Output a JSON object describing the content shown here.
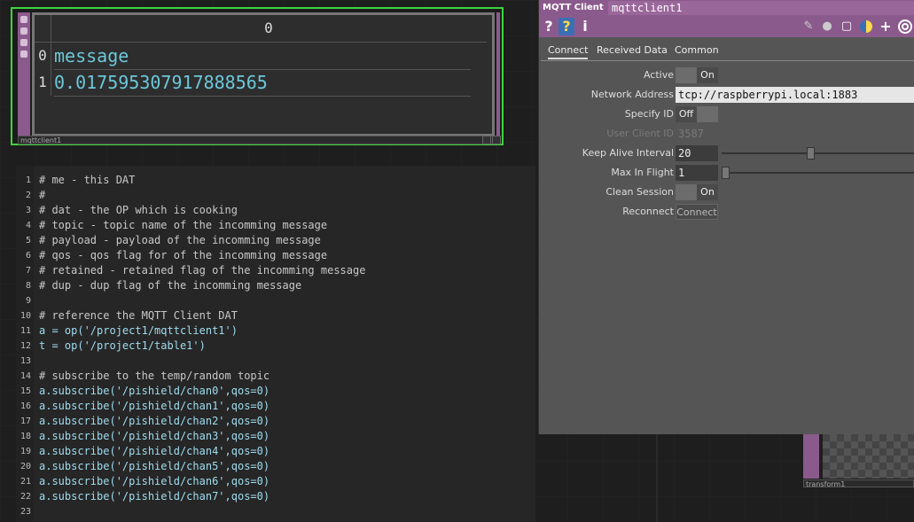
{
  "table_node": {
    "col_header": "0",
    "rows": [
      {
        "index": "0",
        "value": "message"
      },
      {
        "index": "1",
        "value": "0.017595307917888565"
      }
    ],
    "label": "mqttclient1"
  },
  "code": {
    "lines": [
      {
        "n": "1",
        "t": "# me - this DAT",
        "kind": "comment"
      },
      {
        "n": "2",
        "t": "#",
        "kind": "comment"
      },
      {
        "n": "3",
        "t": "# dat - the OP which is cooking",
        "kind": "comment"
      },
      {
        "n": "4",
        "t": "# topic - topic name of the incomming message",
        "kind": "comment"
      },
      {
        "n": "5",
        "t": "# payload - payload of the incomming message",
        "kind": "comment"
      },
      {
        "n": "6",
        "t": "# qos - qos flag for of the incomming message",
        "kind": "comment"
      },
      {
        "n": "7",
        "t": "# retained - retained flag of the incomming message",
        "kind": "comment"
      },
      {
        "n": "8",
        "t": "# dup - dup flag of the incomming message",
        "kind": "comment"
      },
      {
        "n": "9",
        "t": "",
        "kind": "code"
      },
      {
        "n": "10",
        "t": "# reference the MQTT Client DAT",
        "kind": "comment"
      },
      {
        "n": "11",
        "t": "a = op('/project1/mqttclient1')",
        "kind": "code"
      },
      {
        "n": "12",
        "t": "t = op('/project1/table1')",
        "kind": "code"
      },
      {
        "n": "13",
        "t": "",
        "kind": "code"
      },
      {
        "n": "14",
        "t": "# subscribe to the temp/random topic",
        "kind": "comment"
      },
      {
        "n": "15",
        "t": "a.subscribe('/pishield/chan0',qos=0)",
        "kind": "code"
      },
      {
        "n": "16",
        "t": "a.subscribe('/pishield/chan1',qos=0)",
        "kind": "code"
      },
      {
        "n": "17",
        "t": "a.subscribe('/pishield/chan2',qos=0)",
        "kind": "code"
      },
      {
        "n": "18",
        "t": "a.subscribe('/pishield/chan3',qos=0)",
        "kind": "code"
      },
      {
        "n": "19",
        "t": "a.subscribe('/pishield/chan4',qos=0)",
        "kind": "code"
      },
      {
        "n": "20",
        "t": "a.subscribe('/pishield/chan5',qos=0)",
        "kind": "code"
      },
      {
        "n": "21",
        "t": "a.subscribe('/pishield/chan6',qos=0)",
        "kind": "code"
      },
      {
        "n": "22",
        "t": "a.subscribe('/pishield/chan7',qos=0)",
        "kind": "code"
      },
      {
        "n": "23",
        "t": "",
        "kind": "code"
      }
    ]
  },
  "panel": {
    "op_type": "MQTT Client",
    "op_name": "mqttclient1",
    "toolbar": {
      "help": "?",
      "python_help": "?",
      "info": "i"
    },
    "tabs": [
      "Connect",
      "Received Data",
      "Common"
    ],
    "active_tab": "Connect",
    "params": {
      "active": {
        "label": "Active",
        "value": "On"
      },
      "network_address": {
        "label": "Network Address",
        "value": "tcp://raspberrypi.local:1883"
      },
      "specify_id": {
        "label": "Specify ID",
        "value": "Off"
      },
      "user_client_id": {
        "label": "User Client ID",
        "value": "3587"
      },
      "keep_alive": {
        "label": "Keep Alive Interval",
        "value": "20",
        "fraction": 0.44
      },
      "max_in_flight": {
        "label": "Max In Flight",
        "value": "1",
        "fraction": 0.0
      },
      "clean_session": {
        "label": "Clean Session",
        "value": "On"
      },
      "reconnect": {
        "label": "Reconnect",
        "button": "Connect"
      }
    }
  },
  "transform_node": {
    "label": "transform1"
  },
  "colors": {
    "op_purple": "#8b5a8c",
    "selected_green": "#3ed43e",
    "code_cyan": "#9fdcef"
  }
}
